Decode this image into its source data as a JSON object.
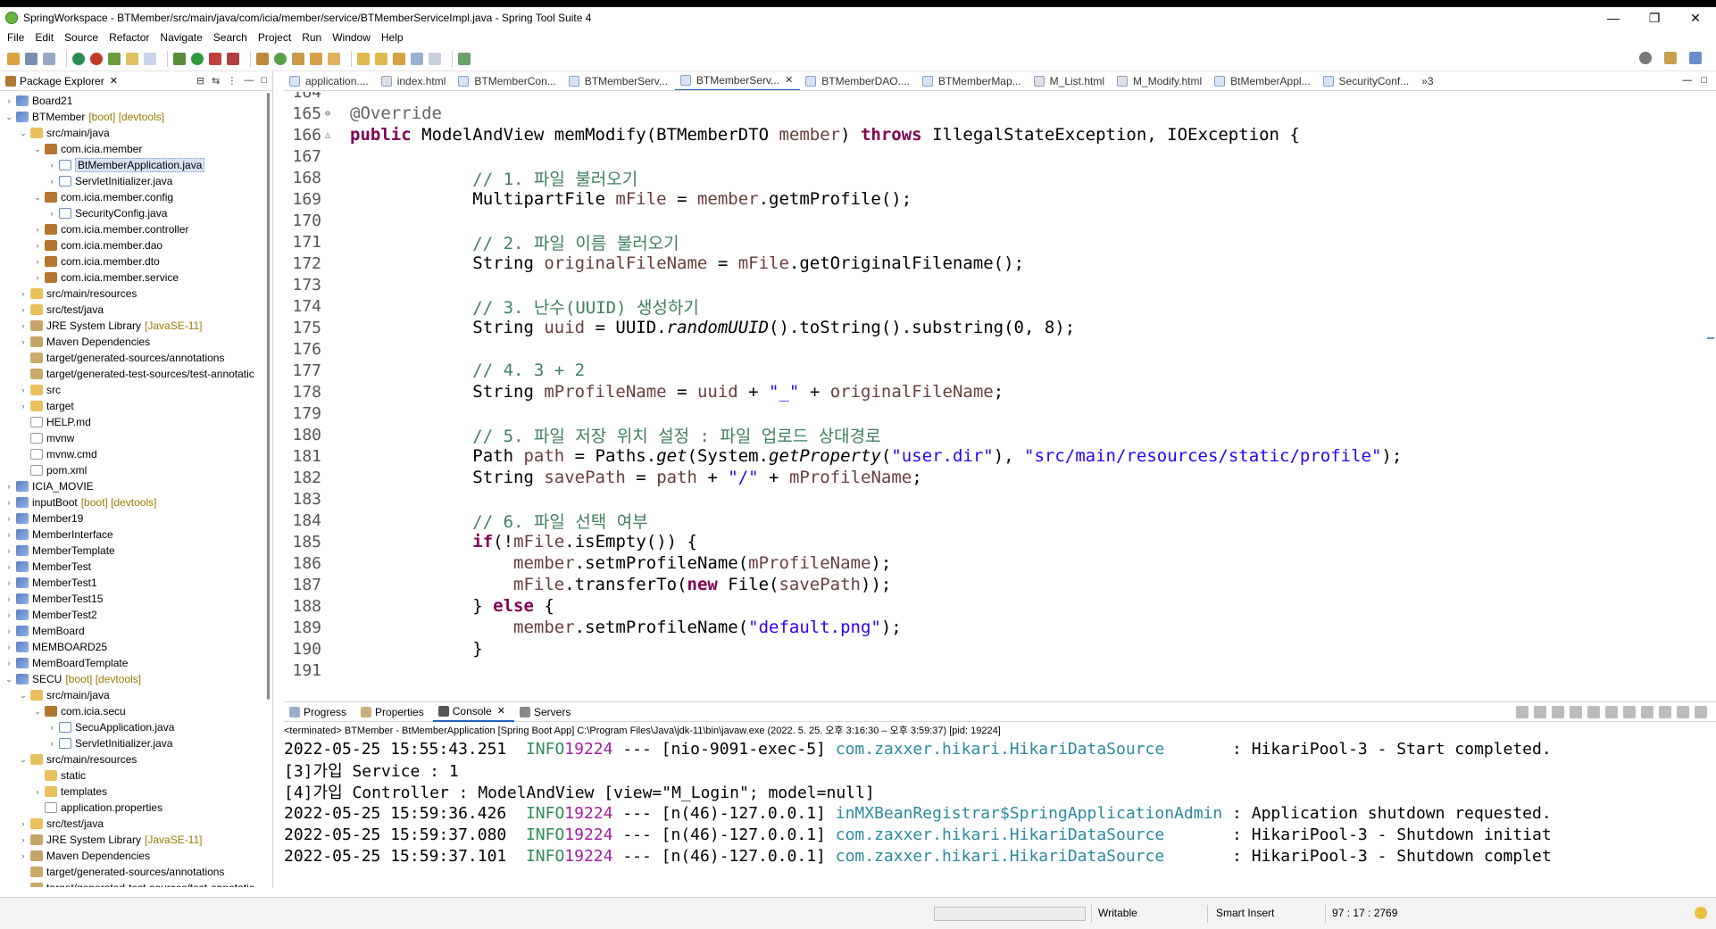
{
  "window": {
    "title": "SpringWorkspace - BTMember/src/main/java/com/icia/member/service/BTMemberServiceImpl.java - Spring Tool Suite 4",
    "minimize": "—",
    "maximize": "❐",
    "close": "✕"
  },
  "menu": [
    "File",
    "Edit",
    "Source",
    "Refactor",
    "Navigate",
    "Search",
    "Project",
    "Run",
    "Window",
    "Help"
  ],
  "explorer": {
    "title": "Package Explorer",
    "close": "✕",
    "rows": [
      {
        "arrow": "›",
        "label": "Board21",
        "deco": "",
        "icon": "project",
        "indent": 0
      },
      {
        "arrow": "⌄",
        "label": "BTMember",
        "deco": "[boot] [devtools]",
        "icon": "project",
        "indent": 0
      },
      {
        "arrow": "⌄",
        "label": "src/main/java",
        "deco": "",
        "icon": "folder",
        "indent": 1
      },
      {
        "arrow": "⌄",
        "label": "com.icia.member",
        "deco": "",
        "icon": "package",
        "indent": 2
      },
      {
        "arrow": "›",
        "label": "BtMemberApplication.java",
        "deco": "",
        "icon": "java",
        "indent": 3,
        "selected": true
      },
      {
        "arrow": "›",
        "label": "ServletInitializer.java",
        "deco": "",
        "icon": "java",
        "indent": 3
      },
      {
        "arrow": "⌄",
        "label": "com.icia.member.config",
        "deco": "",
        "icon": "package",
        "indent": 2
      },
      {
        "arrow": "›",
        "label": "SecurityConfig.java",
        "deco": "",
        "icon": "java",
        "indent": 3
      },
      {
        "arrow": "›",
        "label": "com.icia.member.controller",
        "deco": "",
        "icon": "package",
        "indent": 2
      },
      {
        "arrow": "›",
        "label": "com.icia.member.dao",
        "deco": "",
        "icon": "package",
        "indent": 2
      },
      {
        "arrow": "›",
        "label": "com.icia.member.dto",
        "deco": "",
        "icon": "package",
        "indent": 2
      },
      {
        "arrow": "›",
        "label": "com.icia.member.service",
        "deco": "",
        "icon": "package",
        "indent": 2
      },
      {
        "arrow": "›",
        "label": "src/main/resources",
        "deco": "",
        "icon": "folder",
        "indent": 1
      },
      {
        "arrow": "›",
        "label": "src/test/java",
        "deco": "",
        "icon": "folder",
        "indent": 1
      },
      {
        "arrow": "›",
        "label": "JRE System Library",
        "deco": "[JavaSE-11]",
        "icon": "lib",
        "indent": 1
      },
      {
        "arrow": "›",
        "label": "Maven Dependencies",
        "deco": "",
        "icon": "lib",
        "indent": 1
      },
      {
        "arrow": "",
        "label": "target/generated-sources/annotations",
        "deco": "",
        "icon": "target",
        "indent": 1
      },
      {
        "arrow": "",
        "label": "target/generated-test-sources/test-annotatic",
        "deco": "",
        "icon": "target",
        "indent": 1
      },
      {
        "arrow": "›",
        "label": "src",
        "deco": "",
        "icon": "folder",
        "indent": 1
      },
      {
        "arrow": "›",
        "label": "target",
        "deco": "",
        "icon": "folder",
        "indent": 1
      },
      {
        "arrow": "",
        "label": "HELP.md",
        "deco": "",
        "icon": "file",
        "indent": 1
      },
      {
        "arrow": "",
        "label": "mvnw",
        "deco": "",
        "icon": "file",
        "indent": 1
      },
      {
        "arrow": "",
        "label": "mvnw.cmd",
        "deco": "",
        "icon": "file",
        "indent": 1
      },
      {
        "arrow": "",
        "label": "pom.xml",
        "deco": "",
        "icon": "file",
        "indent": 1
      },
      {
        "arrow": "›",
        "label": "ICIA_MOVIE",
        "deco": "",
        "icon": "project",
        "indent": 0
      },
      {
        "arrow": "›",
        "label": "inputBoot",
        "deco": "[boot] [devtools]",
        "icon": "project",
        "indent": 0
      },
      {
        "arrow": "›",
        "label": "Member19",
        "deco": "",
        "icon": "project",
        "indent": 0
      },
      {
        "arrow": "›",
        "label": "MemberInterface",
        "deco": "",
        "icon": "project",
        "indent": 0
      },
      {
        "arrow": "›",
        "label": "MemberTemplate",
        "deco": "",
        "icon": "project",
        "indent": 0
      },
      {
        "arrow": "›",
        "label": "MemberTest",
        "deco": "",
        "icon": "project",
        "indent": 0
      },
      {
        "arrow": "›",
        "label": "MemberTest1",
        "deco": "",
        "icon": "project",
        "indent": 0
      },
      {
        "arrow": "›",
        "label": "MemberTest15",
        "deco": "",
        "icon": "project",
        "indent": 0
      },
      {
        "arrow": "›",
        "label": "MemberTest2",
        "deco": "",
        "icon": "project",
        "indent": 0
      },
      {
        "arrow": "›",
        "label": "MemBoard",
        "deco": "",
        "icon": "project",
        "indent": 0
      },
      {
        "arrow": "›",
        "label": "MEMBOARD25",
        "deco": "",
        "icon": "project",
        "indent": 0
      },
      {
        "arrow": "›",
        "label": "MemBoardTemplate",
        "deco": "",
        "icon": "project",
        "indent": 0
      },
      {
        "arrow": "⌄",
        "label": "SECU",
        "deco": "[boot] [devtools]",
        "icon": "project",
        "indent": 0
      },
      {
        "arrow": "⌄",
        "label": "src/main/java",
        "deco": "",
        "icon": "folder",
        "indent": 1
      },
      {
        "arrow": "⌄",
        "label": "com.icia.secu",
        "deco": "",
        "icon": "package",
        "indent": 2
      },
      {
        "arrow": "›",
        "label": "SecuApplication.java",
        "deco": "",
        "icon": "java",
        "indent": 3
      },
      {
        "arrow": "›",
        "label": "ServletInitializer.java",
        "deco": "",
        "icon": "java",
        "indent": 3
      },
      {
        "arrow": "⌄",
        "label": "src/main/resources",
        "deco": "",
        "icon": "folder",
        "indent": 1
      },
      {
        "arrow": "",
        "label": "static",
        "deco": "",
        "icon": "folder",
        "indent": 2
      },
      {
        "arrow": "›",
        "label": "templates",
        "deco": "",
        "icon": "folder",
        "indent": 2
      },
      {
        "arrow": "",
        "label": "application.properties",
        "deco": "",
        "icon": "file",
        "indent": 2
      },
      {
        "arrow": "›",
        "label": "src/test/java",
        "deco": "",
        "icon": "folder",
        "indent": 1
      },
      {
        "arrow": "›",
        "label": "JRE System Library",
        "deco": "[JavaSE-11]",
        "icon": "lib",
        "indent": 1
      },
      {
        "arrow": "›",
        "label": "Maven Dependencies",
        "deco": "",
        "icon": "lib",
        "indent": 1
      },
      {
        "arrow": "",
        "label": "target/generated-sources/annotations",
        "deco": "",
        "icon": "target",
        "indent": 1
      },
      {
        "arrow": "",
        "label": "target/generated-test-sources/test-annotatic",
        "deco": "",
        "icon": "target",
        "indent": 1
      }
    ]
  },
  "editor": {
    "tabs": [
      {
        "label": "application....",
        "active": false
      },
      {
        "label": "index.html",
        "active": false
      },
      {
        "label": "BTMemberCon...",
        "active": false
      },
      {
        "label": "BTMemberServ...",
        "active": false
      },
      {
        "label": "BTMemberServ...",
        "active": true
      },
      {
        "label": "BTMemberDAO....",
        "active": false
      },
      {
        "label": "BTMemberMap...",
        "active": false
      },
      {
        "label": "M_List.html",
        "active": false
      },
      {
        "label": "M_Modify.html",
        "active": false
      },
      {
        "label": "BtMemberAppl...",
        "active": false
      },
      {
        "label": "SecurityConf...",
        "active": false
      }
    ],
    "overflow": "»3",
    "lines": [
      {
        "n": "164",
        "html": ""
      },
      {
        "n": "165",
        "mark": "⊖",
        "html": "<span class=\"ann\">@Override</span>"
      },
      {
        "n": "166",
        "mark": "△",
        "html": "<span class=\"kw\">public</span> ModelAndView memModify(BTMemberDTO <span class=\"fld\">member</span>) <span class=\"kw\">throws</span> IllegalStateException, IOException {"
      },
      {
        "n": "167",
        "html": ""
      },
      {
        "n": "168",
        "html": "            <span class=\"cm\">// 1. 파일 불러오기</span>"
      },
      {
        "n": "169",
        "html": "            MultipartFile <span class=\"fld\">mFile</span> = <span class=\"fld\">member</span>.getmProfile();"
      },
      {
        "n": "170",
        "html": ""
      },
      {
        "n": "171",
        "html": "            <span class=\"cm\">// 2. 파일 이름 불러오기</span>"
      },
      {
        "n": "172",
        "html": "            String <span class=\"fld\">originalFileName</span> = <span class=\"fld\">mFile</span>.getOriginalFilename();"
      },
      {
        "n": "173",
        "html": ""
      },
      {
        "n": "174",
        "html": "            <span class=\"cm\">// 3. 난수(UUID) 생성하기</span>"
      },
      {
        "n": "175",
        "html": "            String <span class=\"fld\">uuid</span> = UUID.<span class=\"it\">randomUUID</span>().toString().substring(0, 8);"
      },
      {
        "n": "176",
        "html": ""
      },
      {
        "n": "177",
        "html": "            <span class=\"cm\">// 4. 3 + 2</span>"
      },
      {
        "n": "178",
        "html": "            String <span class=\"fld\">mProfileName</span> = <span class=\"fld\">uuid</span> + <span class=\"st\">\"_\"</span> + <span class=\"fld\">originalFileName</span>;"
      },
      {
        "n": "179",
        "html": ""
      },
      {
        "n": "180",
        "html": "            <span class=\"cm\">// 5. 파일 저장 위치 설정 : 파일 업로드 상대경로</span>"
      },
      {
        "n": "181",
        "html": "            Path <span class=\"fld\">path</span> = Paths.<span class=\"it\">get</span>(System.<span class=\"it\">getProperty</span>(<span class=\"st\">\"user.dir\"</span>), <span class=\"st\">\"src/main/resources/static/profile\"</span>);"
      },
      {
        "n": "182",
        "html": "            String <span class=\"fld\">savePath</span> = <span class=\"fld\">path</span> + <span class=\"st\">\"/\"</span> + <span class=\"fld\">mProfileName</span>;"
      },
      {
        "n": "183",
        "html": ""
      },
      {
        "n": "184",
        "html": "            <span class=\"cm\">// 6. 파일 선택 여부</span>"
      },
      {
        "n": "185",
        "html": "            <span class=\"kw\">if</span>(!<span class=\"fld\">mFile</span>.isEmpty()) {"
      },
      {
        "n": "186",
        "html": "                <span class=\"fld\">member</span>.setmProfileName(<span class=\"fld\">mProfileName</span>);"
      },
      {
        "n": "187",
        "html": "                <span class=\"fld\">mFile</span>.transferTo(<span class=\"kw\">new</span> File(<span class=\"fld\">savePath</span>));"
      },
      {
        "n": "188",
        "html": "            } <span class=\"kw\">else</span> {"
      },
      {
        "n": "189",
        "html": "                <span class=\"fld\">member</span>.setmProfileName(<span class=\"st\">\"default.png\"</span>);"
      },
      {
        "n": "190",
        "html": "            }"
      },
      {
        "n": "191",
        "html": ""
      }
    ]
  },
  "console": {
    "tabs": [
      {
        "label": "Progress",
        "active": false
      },
      {
        "label": "Properties",
        "active": false
      },
      {
        "label": "Console",
        "active": true
      },
      {
        "label": "Servers",
        "active": false
      }
    ],
    "close": "✕",
    "status": "<terminated> BTMember - BtMemberApplication [Spring Boot App] C:\\Program Files\\Java\\jdk-11\\bin\\javaw.exe  (2022. 5. 25. 오후 3:16:30 – 오후 3:59:37) [pid: 19224]",
    "lines": [
      {
        "html": "2022-05-25 15:55:43.251  <span class=\"info\">INFO</span> <span class=\"pid\">19224</span> --- [nio-9091-exec-5] <span class=\"cls\">com.zaxxer.hikari.HikariDataSource      </span> : HikariPool-3 - Start completed."
      },
      {
        "html": "[3]가입 Service : 1"
      },
      {
        "html": "[4]가입 Controller : ModelAndView [view=\"M_Login\"; model=null]"
      },
      {
        "html": "2022-05-25 15:59:36.426  <span class=\"info\">INFO</span> <span class=\"pid\">19224</span> --- [n(46)-127.0.0.1] <span class=\"cls\">inMXBeanRegistrar$SpringApplicationAdmin</span> : Application shutdown requested."
      },
      {
        "html": "2022-05-25 15:59:37.080  <span class=\"info\">INFO</span> <span class=\"pid\">19224</span> --- [n(46)-127.0.0.1] <span class=\"cls\">com.zaxxer.hikari.HikariDataSource      </span> : HikariPool-3 - Shutdown initiat"
      },
      {
        "html": "2022-05-25 15:59:37.101  <span class=\"info\">INFO</span> <span class=\"pid\">19224</span> --- [n(46)-127.0.0.1] <span class=\"cls\">com.zaxxer.hikari.HikariDataSource      </span> : HikariPool-3 - Shutdown complet"
      }
    ]
  },
  "status": {
    "writable": "Writable",
    "insert_mode": "Smart Insert",
    "position": "97 : 17 : 2769"
  },
  "colors": {
    "keyword": "#7f0055",
    "comment": "#3f7f5f",
    "string": "#2a00ff",
    "field": "#6a3e3e",
    "active_tab": "#2060c0"
  }
}
